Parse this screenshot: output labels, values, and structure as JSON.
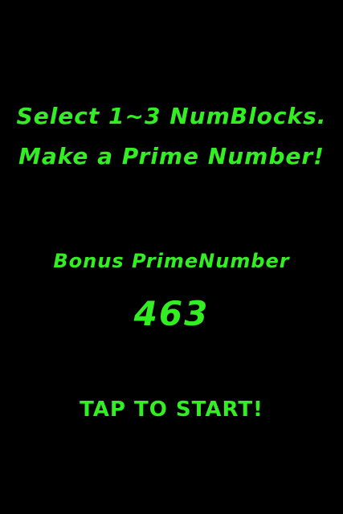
{
  "instructions": {
    "line1": "Select 1~3 NumBlocks.",
    "line2": "Make a Prime Number!"
  },
  "bonus": {
    "label": "Bonus PrimeNumber",
    "value": "463"
  },
  "start": {
    "label": "TAP TO START!"
  },
  "colors": {
    "background": "#000000",
    "text": "#33ee22"
  }
}
